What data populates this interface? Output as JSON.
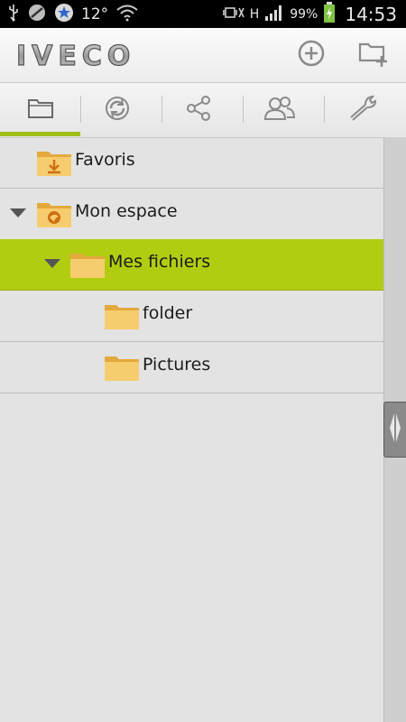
{
  "status_bar": {
    "left_icons": [
      "usb-icon",
      "blocked-icon",
      "star-icon"
    ],
    "temperature": "12°",
    "right_icons": [
      "wifi-icon",
      "silent-icon",
      "data-icon",
      "signal-icon",
      "battery-charging-icon"
    ],
    "network_type": "H",
    "battery": "99%",
    "time": "14:53"
  },
  "header": {
    "logo": "IVECO",
    "actions": [
      {
        "name": "add",
        "icon": "plus-circle-icon"
      },
      {
        "name": "new-folder",
        "icon": "folder-plus-icon"
      }
    ]
  },
  "tabs": [
    {
      "name": "files",
      "icon": "folder-icon",
      "active": true
    },
    {
      "name": "sync",
      "icon": "sync-icon",
      "active": false
    },
    {
      "name": "share",
      "icon": "share-icon",
      "active": false
    },
    {
      "name": "contacts",
      "icon": "contacts-icon",
      "active": false
    },
    {
      "name": "settings",
      "icon": "wrench-icon",
      "active": false
    }
  ],
  "tree": {
    "items": [
      {
        "label": "Favoris",
        "level": 0,
        "expandable": false,
        "selected": false,
        "icon": "favorites-folder-icon"
      },
      {
        "label": "Mon espace",
        "level": 0,
        "expandable": true,
        "selected": false,
        "icon": "space-folder-icon"
      },
      {
        "label": "Mes fichiers",
        "level": 1,
        "expandable": true,
        "selected": true,
        "icon": "folder-icon"
      },
      {
        "label": "folder",
        "level": 2,
        "expandable": false,
        "selected": false,
        "icon": "folder-icon"
      },
      {
        "label": "Pictures",
        "level": 2,
        "expandable": false,
        "selected": false,
        "icon": "folder-icon"
      }
    ]
  },
  "colors": {
    "selected_row": "#b2cd11",
    "tab_indicator": "#9fbf1a",
    "folder": "#f2c35c"
  }
}
